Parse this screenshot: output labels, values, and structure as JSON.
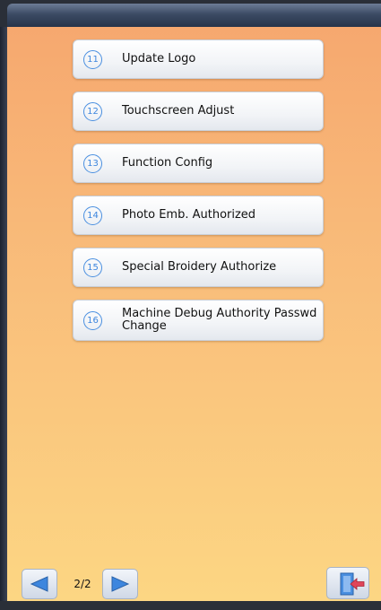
{
  "menu": {
    "items": [
      {
        "num": "11",
        "label": "Update Logo"
      },
      {
        "num": "12",
        "label": "Touchscreen Adjust"
      },
      {
        "num": "13",
        "label": "Function Config"
      },
      {
        "num": "14",
        "label": "Photo Emb. Authorized"
      },
      {
        "num": "15",
        "label": "Special Broidery Authorize"
      },
      {
        "num": "16",
        "label": "Machine Debug Authority Passwd\nChange"
      }
    ]
  },
  "pager": {
    "indicator": "2/2"
  },
  "icons": {
    "prev": "arrow-left-icon",
    "next": "arrow-right-icon",
    "exit": "exit-door-icon"
  },
  "colors": {
    "accent": "#3d86de",
    "exit_arrow": "#e0455a"
  }
}
